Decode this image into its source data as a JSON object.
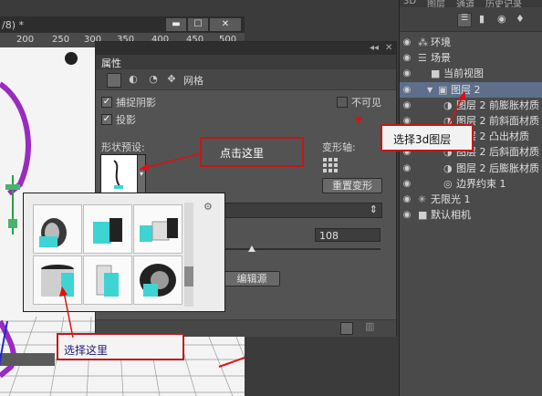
{
  "doc": {
    "title": "/8) *",
    "ruler_ticks": [
      "200",
      "250",
      "300",
      "350",
      "400",
      "450",
      "500"
    ],
    "win_min": "▬",
    "win_max": "☐",
    "win_close": "✕"
  },
  "props": {
    "panel_title": "属性",
    "collapse": "◂◂",
    "close": "✕",
    "toolbar_label": "网格",
    "capture_shadows": "捕捉阴影",
    "invisible": "不可见",
    "cast_shadows": "投影",
    "shape_preset_label": "形状预设:",
    "deform_axis_label": "变形轴:",
    "reset_deform": "重置变形",
    "value_108": "108",
    "edit_source": "编辑源"
  },
  "annotations": {
    "click_here": "点击这里",
    "select_here": "选择这里",
    "select_layer": "选择3d图层"
  },
  "panel3d": {
    "tabs": [
      "3D",
      "图层",
      "通道",
      "历史记录"
    ],
    "items": [
      {
        "label": "环境",
        "indent": 0,
        "icon": "env"
      },
      {
        "label": "场景",
        "indent": 0,
        "icon": "scene"
      },
      {
        "label": "当前视图",
        "indent": 1,
        "icon": "camera"
      },
      {
        "label": "图层 2",
        "indent": 1,
        "icon": "mesh",
        "selected": true
      },
      {
        "label": "图层 2 前膨胀材质",
        "indent": 2,
        "icon": "material"
      },
      {
        "label": "图层 2 前斜面材质",
        "indent": 2,
        "icon": "material"
      },
      {
        "label": "图层 2 凸出材质",
        "indent": 2,
        "icon": "material"
      },
      {
        "label": "图层 2 后斜面材质",
        "indent": 2,
        "icon": "material"
      },
      {
        "label": "图层 2 后膨胀材质",
        "indent": 2,
        "icon": "material"
      },
      {
        "label": "边界约束 1",
        "indent": 2,
        "icon": "constraint"
      },
      {
        "label": "无限光 1",
        "indent": 0,
        "icon": "light"
      },
      {
        "label": "默认相机",
        "indent": 0,
        "icon": "camera"
      }
    ]
  }
}
